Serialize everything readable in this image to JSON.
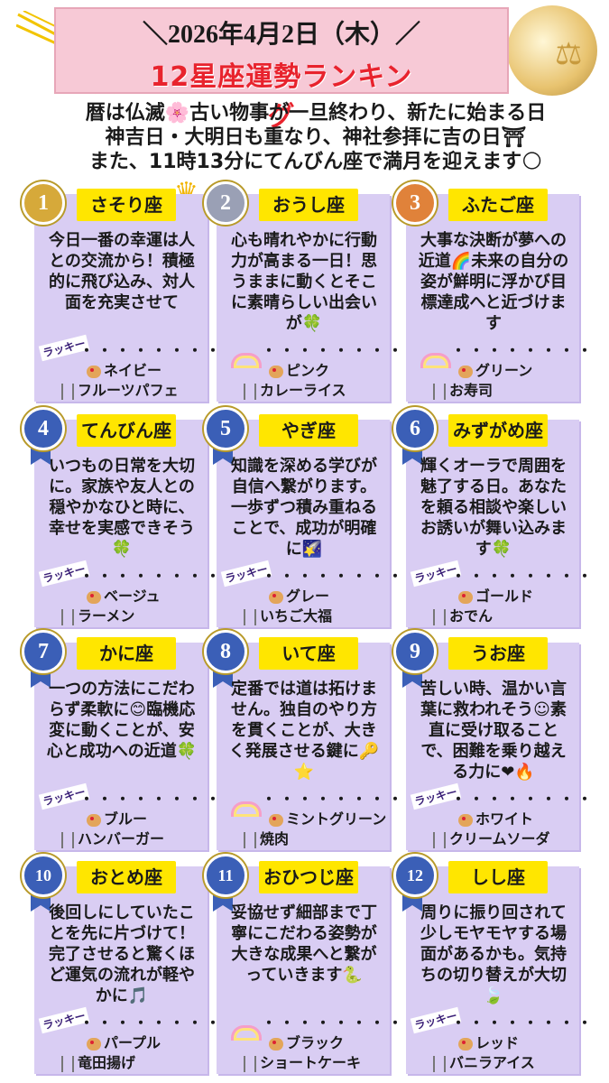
{
  "header": {
    "date": "＼2026年4月2日（木）／",
    "title": "12星座運勢ランキング"
  },
  "intro": {
    "line1": "暦は仏滅🌸古い物事が一旦終わり、新たに始まる日",
    "line2": "神吉日・大明日も重なり、神社参拝に吉の日⛩",
    "line3": "また、11時13分にてんびん座で満月を迎えます🌕"
  },
  "lucky_tag": "ラッキー",
  "dots": "・・・・・・・・",
  "cards": [
    {
      "rank": "1",
      "sign": "さそり座",
      "message": "今日一番の幸運は人との交流から！積極的に飛び込み、対人面を充実させて",
      "color": "ネイビー",
      "food": "フルーツパフェ"
    },
    {
      "rank": "2",
      "sign": "おうし座",
      "message": "心も晴れやかに行動力が高まる一日！思うままに動くとそこに素晴らしい出会いが🍀",
      "color": "ピンク",
      "food": "カレーライス"
    },
    {
      "rank": "3",
      "sign": "ふたご座",
      "message": "大事な決断が夢への近道🌈未来の自分の姿が鮮明に浮かび目標達成へと近づけます",
      "color": "グリーン",
      "food": "お寿司"
    },
    {
      "rank": "4",
      "sign": "てんびん座",
      "message": "いつもの日常を大切に。家族や友人との穏やかなひと時に、幸せを実感できそう🍀",
      "color": "ベージュ",
      "food": "ラーメン"
    },
    {
      "rank": "5",
      "sign": "やぎ座",
      "message": "知識を深める学びが自信へ繋がります。一歩ずつ積み重ねることで、成功が明確に🌠",
      "color": "グレー",
      "food": "いちご大福"
    },
    {
      "rank": "6",
      "sign": "みずがめ座",
      "message": "輝くオーラで周囲を魅了する日。あなたを頼る相談や楽しいお誘いが舞い込みます🍀",
      "color": "ゴールド",
      "food": "おでん"
    },
    {
      "rank": "7",
      "sign": "かに座",
      "message": "一つの方法にこだわらず柔軟に😊臨機応変に動くことが、安心と成功への近道🍀",
      "color": "ブルー",
      "food": "ハンバーガー"
    },
    {
      "rank": "8",
      "sign": "いて座",
      "message": "定番では道は拓けません。独自のやり方を貫くことが、大きく発展させる鍵に🔑⭐",
      "color": "ミントグリーン",
      "food": "焼肉"
    },
    {
      "rank": "9",
      "sign": "うお座",
      "message": "苦しい時、温かい言葉に救われそう☺素直に受け取ることで、困難を乗り越える力に❤🔥",
      "color": "ホワイト",
      "food": "クリームソーダ"
    },
    {
      "rank": "10",
      "sign": "おとめ座",
      "message": "後回しにしていたことを先に片づけて！完了させると驚くほど運気の流れが軽やかに🎵",
      "color": "パープル",
      "food": "竜田揚げ"
    },
    {
      "rank": "11",
      "sign": "おひつじ座",
      "message": "妥協せず細部まで丁寧にこだわる姿勢が大きな成果へと繋がっていきます🐍",
      "color": "ブラック",
      "food": "ショートケーキ"
    },
    {
      "rank": "12",
      "sign": "しし座",
      "message": "周りに振り回されて少しモヤモヤする場面があるかも。気持ちの切り替えが大切🍃",
      "color": "レッド",
      "food": "バニラアイス"
    }
  ],
  "colors": {
    "card_bg": "#d9cdf3",
    "name_bg": "#ffe600",
    "title_red": "#e8232d",
    "header_pink": "#f7c9d6",
    "gold": "#d6a93a",
    "silver": "#9aa0b5",
    "bronze": "#e0823a",
    "blue_medal": "#3b5fb7"
  }
}
